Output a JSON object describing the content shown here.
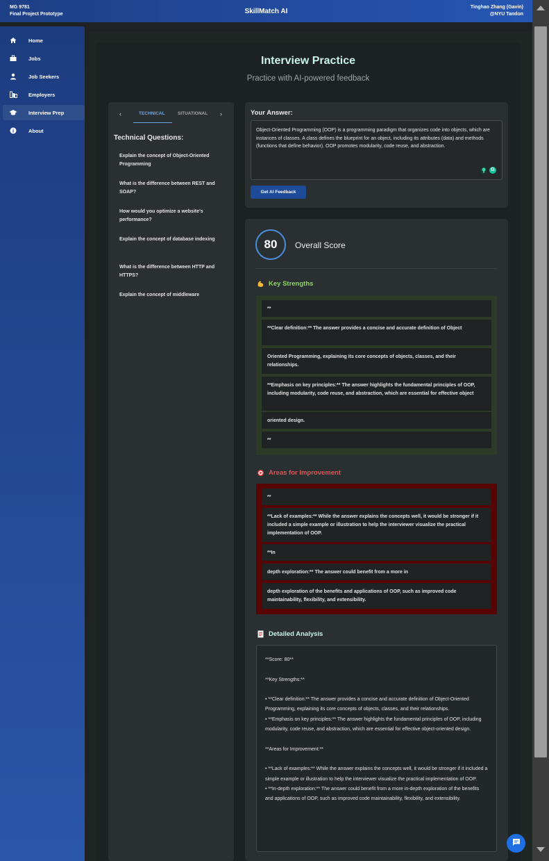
{
  "header": {
    "course": "MG 9781",
    "project": "Final Project Prototype",
    "app_title": "SkillMatch AI",
    "user_name": "Tinghao Zhang (Gavin)",
    "user_affiliation": "@NYU Tandon"
  },
  "sidebar": {
    "items": [
      {
        "label": "Home",
        "icon": "home-icon"
      },
      {
        "label": "Jobs",
        "icon": "briefcase-icon"
      },
      {
        "label": "Job Seekers",
        "icon": "person-icon"
      },
      {
        "label": "Employers",
        "icon": "building-icon"
      },
      {
        "label": "Interview Prep",
        "icon": "graduation-cap-icon",
        "active": true
      },
      {
        "label": "About",
        "icon": "info-icon"
      }
    ]
  },
  "page": {
    "title": "Interview Practice",
    "subtitle": "Practice with AI-powered feedback"
  },
  "questions": {
    "tabs": [
      "TECHNICAL",
      "SITUATIONAL"
    ],
    "active_tab": "TECHNICAL",
    "heading": "Technical Questions:",
    "items": [
      "Explain the concept of Object-Oriented Programming",
      "What is the difference between REST and SOAP?",
      "How would you optimize a website's performance?",
      "Explain the concept of database indexing",
      "What is the difference between HTTP and HTTPS?",
      "Explain the concept of middleware"
    ]
  },
  "answer": {
    "label": "Your Answer:",
    "text": "Object-Oriented Programming (OOP) is a programming paradigm that organizes code into objects, which are instances of classes. A class defines the blueprint for an object, including its attributes (data) and methods (functions that define behavior). OOP promotes modularity, code reuse, and abstraction.",
    "button_label": "Get AI Feedback"
  },
  "feedback": {
    "score": "80",
    "score_label": "Overall Score",
    "strengths_heading": "Key Strengths",
    "strengths": [
      "**",
      "**Clear definition:** The answer provides a concise and accurate definition of Object",
      "Oriented Programming, explaining its core concepts of objects, classes, and their relationships.",
      "**Emphasis on key principles:** The answer highlights the fundamental principles of OOP, including modularity, code reuse, and abstraction, which are essential for effective object",
      "oriented design.",
      "**"
    ],
    "improvement_heading": "Areas for Improvement",
    "improvements": [
      "**",
      "**Lack of examples:** While the answer explains the concepts well, it would be stronger if it included a simple example or illustration to help the interviewer visualize the practical implementation of OOP.",
      "**In",
      "depth exploration:** The answer could benefit from a more in",
      "depth exploration of the benefits and applications of OOP, such as improved code maintainability, flexibility, and extensibility."
    ],
    "analysis_heading": "Detailed Analysis",
    "analysis_text": "**Score: 80**\n\n**Key Strengths:**\n\n• **Clear definition:** The answer provides a concise and accurate definition of Object-Oriented Programming, explaining its core concepts of objects, classes, and their relationships.\n• **Emphasis on key principles:** The answer highlights the fundamental principles of OOP, including modularity, code reuse, and abstraction, which are essential for effective object-oriented design.\n\n**Areas for Improvement:**\n\n• **Lack of examples:** While the answer explains the concepts well, it would be stronger if it included a simple example or illustration to help the interviewer visualize the practical implementation of OOP.\n• **In-depth exploration:** The answer could benefit from a more in-depth exploration of the benefits and applications of OOP, such as improved code maintainability, flexibility, and extensibility."
  },
  "colors": {
    "accent": "#1e4b97",
    "score_ring": "#4a8ee0",
    "strengths": "#8fd46a",
    "improvement": "#e05555",
    "title": "#c9f2ea"
  }
}
